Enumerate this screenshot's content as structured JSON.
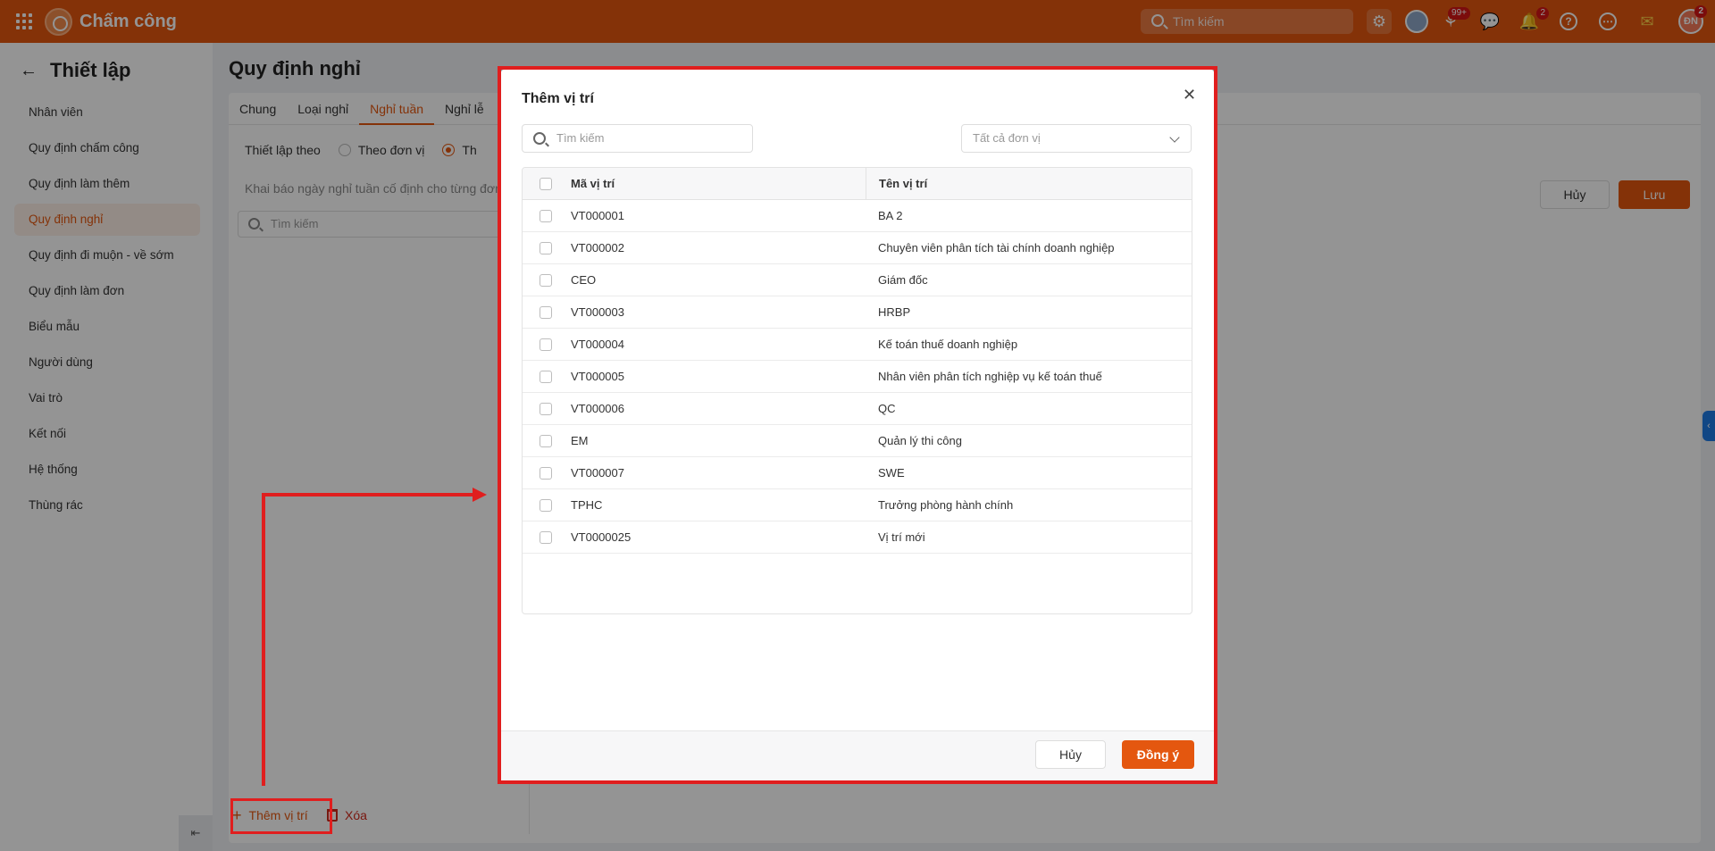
{
  "app": {
    "title": "Chấm công"
  },
  "topbar": {
    "search_placeholder": "Tìm kiếm",
    "notif_badge_1": "99+",
    "notif_badge_2": "2",
    "user_badge": "2",
    "user_initials": "ĐN"
  },
  "sidebar": {
    "title": "Thiết lập",
    "items": [
      {
        "label": "Nhân viên"
      },
      {
        "label": "Quy định chấm công"
      },
      {
        "label": "Quy định làm thêm"
      },
      {
        "label": "Quy định nghỉ"
      },
      {
        "label": "Quy định đi muộn - về sớm"
      },
      {
        "label": "Quy định làm đơn"
      },
      {
        "label": "Biểu mẫu"
      },
      {
        "label": "Người dùng"
      },
      {
        "label": "Vai trò"
      },
      {
        "label": "Kết nối"
      },
      {
        "label": "Hệ thống"
      },
      {
        "label": "Thùng rác"
      }
    ],
    "active_index": 3
  },
  "main": {
    "title": "Quy định nghỉ",
    "tabs": [
      {
        "label": "Chung"
      },
      {
        "label": "Loại nghỉ"
      },
      {
        "label": "Nghỉ tuần"
      },
      {
        "label": "Nghỉ lễ"
      }
    ],
    "setup_label": "Thiết lập theo",
    "radio_unit": "Theo đơn vị",
    "radio_position": "Th",
    "description": "Khai báo ngày nghỉ tuần cố định cho từng đơn",
    "search_placeholder": "Tìm kiếm",
    "cancel_label": "Hủy",
    "save_label": "Lưu",
    "add_position_label": "Thêm vị trí",
    "delete_label": "Xóa"
  },
  "modal": {
    "title": "Thêm vị trí",
    "search_placeholder": "Tìm kiếm",
    "unit_select": "Tất cả đơn vị",
    "columns": {
      "code": "Mã vị trí",
      "name": "Tên vị trí"
    },
    "rows": [
      {
        "code": "VT000001",
        "name": "BA 2"
      },
      {
        "code": "VT000002",
        "name": "Chuyên viên phân tích tài chính doanh nghiệp"
      },
      {
        "code": "CEO",
        "name": "Giám đốc"
      },
      {
        "code": "VT000003",
        "name": "HRBP"
      },
      {
        "code": "VT000004",
        "name": "Kế toán thuế doanh nghiệp"
      },
      {
        "code": "VT000005",
        "name": "Nhân viên phân tích nghiệp vụ kế toán thuế"
      },
      {
        "code": "VT000006",
        "name": "QC"
      },
      {
        "code": "EM",
        "name": "Quản lý thi công"
      },
      {
        "code": "VT000007",
        "name": "SWE"
      },
      {
        "code": "TPHC",
        "name": "Trưởng phòng hành chính"
      },
      {
        "code": "VT0000025",
        "name": "Vị trí mới"
      }
    ],
    "cancel_label": "Hủy",
    "ok_label": "Đồng ý"
  },
  "colors": {
    "brand": "#e4570f",
    "annotation": "#e01e1e"
  }
}
